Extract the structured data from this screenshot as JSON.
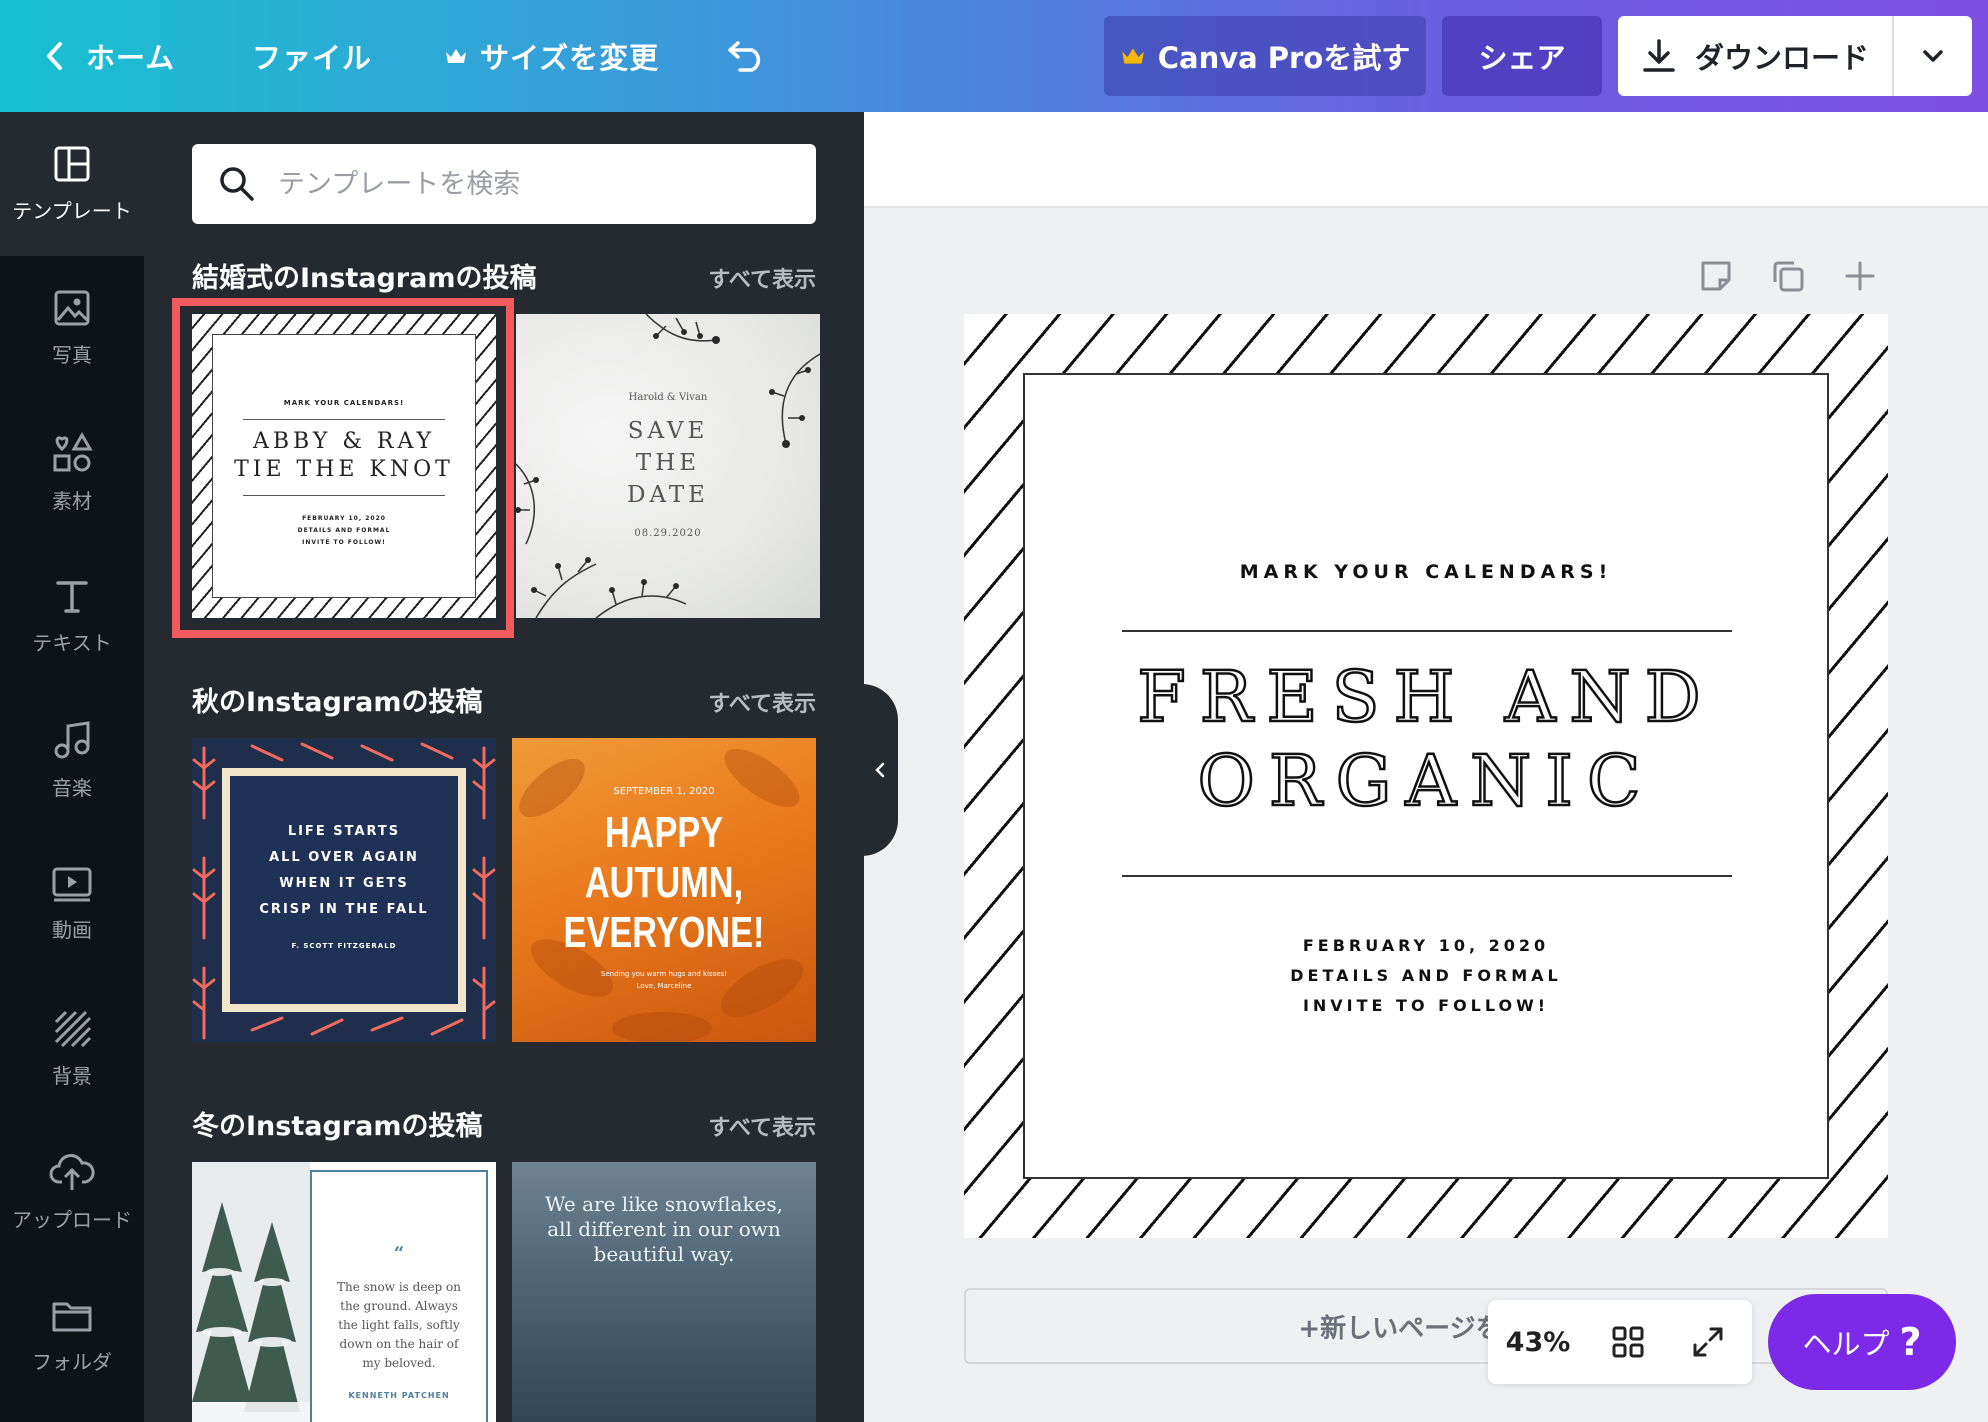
{
  "topbar": {
    "home_label": "ホーム",
    "file_label": "ファイル",
    "resize_label": "サイズを変更",
    "pro_label": "Canva Proを試す",
    "share_label": "シェア",
    "download_label": "ダウンロード",
    "gradient_colors": [
      "#18c1d0",
      "#3f95dc",
      "#7c4fe0"
    ]
  },
  "rail": {
    "items": [
      {
        "label": "テンプレート",
        "icon": "template-icon"
      },
      {
        "label": "写真",
        "icon": "photo-icon"
      },
      {
        "label": "素材",
        "icon": "elements-icon"
      },
      {
        "label": "テキスト",
        "icon": "text-icon"
      },
      {
        "label": "音楽",
        "icon": "music-icon"
      },
      {
        "label": "動画",
        "icon": "video-icon"
      },
      {
        "label": "背景",
        "icon": "background-icon"
      },
      {
        "label": "アップロード",
        "icon": "upload-icon"
      },
      {
        "label": "フォルダ",
        "icon": "folder-icon"
      }
    ]
  },
  "panel": {
    "search_placeholder": "テンプレートを検索",
    "see_all": "すべて表示",
    "sections": [
      {
        "title": "結婚式のInstagramの投稿"
      },
      {
        "title": "秋のInstagramの投稿"
      },
      {
        "title": "冬のInstagramの投稿"
      }
    ],
    "thumbs": {
      "t1": {
        "top": "MARK YOUR CALENDARS!",
        "line1": "ABBY & RAY",
        "line2": "TIE THE KNOT",
        "f1": "FEBRUARY 10, 2020",
        "f2": "DETAILS AND FORMAL",
        "f3": "INVITE TO FOLLOW!"
      },
      "t2": {
        "names": "Harold & Vivan",
        "l1": "SAVE",
        "l2": "THE",
        "l3": "DATE",
        "date": "08.29.2020"
      },
      "t3": {
        "l1": "LIFE STARTS",
        "l2": "ALL OVER AGAIN",
        "l3": "WHEN IT GETS",
        "l4": "CRISP IN THE FALL",
        "author": "F. SCOTT FITZGERALD"
      },
      "t4": {
        "date": "SEPTEMBER 1, 2020",
        "l1": "HAPPY",
        "l2": "AUTUMN,",
        "l3": "EVERYONE!",
        "s1": "Sending you warm hugs and kisses!",
        "s2": "Love, Marceline"
      },
      "t5": {
        "mark": "“",
        "q1": "The snow is deep on",
        "q2": "the ground. Always",
        "q3": "the light falls, softly",
        "q4": "down on the hair of",
        "q5": "my beloved.",
        "author": "KENNETH PATCHEN"
      },
      "t6": {
        "q1": "We are like snowflakes,",
        "q2": "all different in our own",
        "q3": "beautiful way."
      }
    },
    "selection_color": "#f15b5b"
  },
  "page": {
    "top": "MARK YOUR CALENDARS!",
    "big1": "FRESH AND",
    "big2": "ORGANIC",
    "f1": "FEBRUARY 10, 2020",
    "f2": "DETAILS AND FORMAL",
    "f3": "INVITE TO FOLLOW!"
  },
  "canvas": {
    "add_page_label": "+新しいページを追加",
    "zoom": "43%",
    "help_label": "ヘルプ",
    "help_mark": "?",
    "help_color": "#7d2ae8"
  }
}
